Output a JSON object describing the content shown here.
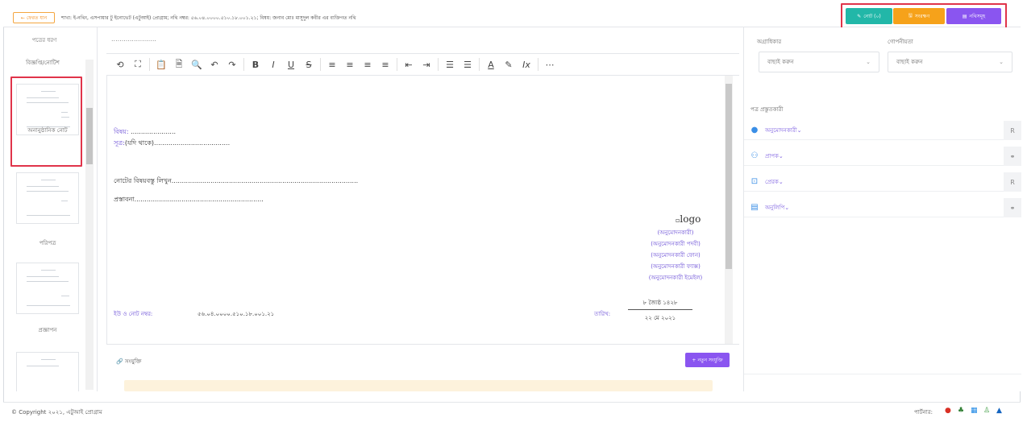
{
  "header": {
    "back_label": "ফেরত যান",
    "breadcrumb": "শাখা: ই-নথিং, এসপায়ার টু ইনোভেট (এটুআই) প্রোগ্রাম; নথি নম্বর: ৫৬.০৪.০০০০.৫১০.১৮.০০১.২১; বিষয়: জনাব মোঃ মাসুদুল কবীর এর ব্যক্তিগত নথি",
    "buttons": [
      {
        "label": "নোট (০)",
        "color": "#22b7a8"
      },
      {
        "label": "সংরক্ষণ",
        "color": "#f6a21a"
      },
      {
        "label": "নথিসমূহ",
        "color": "#8a55f0"
      }
    ]
  },
  "left": {
    "heading": "পত্রের ধরণ",
    "items": [
      {
        "label": "বিজ্ঞপ্তি/নোটিশ"
      },
      {
        "label": "অনানুষ্ঠানিক নোট"
      },
      {
        "label": "পরিপত্র"
      },
      {
        "label": "প্রজ্ঞাপন"
      }
    ]
  },
  "editor": {
    "top_dots": "......................",
    "toolbar": [
      "⟲",
      "⛶",
      "📋",
      "🗎",
      "🔍",
      "↶",
      "↷",
      "B",
      "I",
      "U",
      "S",
      "≡",
      "≡",
      "≡",
      "≡",
      "⇤",
      "⇥",
      "☰",
      "☰",
      "A",
      "✎",
      "Ix",
      "⋯"
    ],
    "subject_label": "বিষয়:",
    "subject_dots": "......................",
    "ref_label": "সূত্র:",
    "ref_text": "(যদি থাকে).....................................",
    "note_text": "নোটের বিষয়বস্তু লিখুন...........................................................................................",
    "proposal_text": "প্রস্তাবনা...............................................................",
    "logo_alt": "logo",
    "approver_lines": [
      "(অনুমোদনকারী)",
      "(অনুমোদনকারী পদবী)",
      "(অনুমোদনকারী ফোন)",
      "(অনুমোদনকারী ফ্যাক্স)",
      "(অনুমোদনকারী ইমেইল)"
    ],
    "note_no_label": "ইউ ও নোট নম্বর:",
    "note_no_value": "৫৬.০৪.০০০০.৫১০.১৮.০০১.২১",
    "date_label": "তারিখ:",
    "date_bn": "৮ জ্যৈষ্ঠ ১৪২৮",
    "date_en": "২২ মে ২০২১"
  },
  "attachments": {
    "label": "সংযুক্তি",
    "new_label": "নতুন সংযুক্তি"
  },
  "right": {
    "priority_label": "অগ্রাধিকার",
    "priority_value": "বাছাই করুন",
    "secrecy_label": "গোপনীয়তা",
    "secrecy_value": "বাছাই করুন",
    "section_label": "পত্র প্রস্তুতকারী",
    "rows": [
      {
        "label": "অনুমোদনকারী",
        "icon": "user-icon"
      },
      {
        "label": "প্রাপক",
        "icon": "users-icon"
      },
      {
        "label": "প্রেরক",
        "icon": "sender-icon"
      },
      {
        "label": "অনুলিপি",
        "icon": "copy-icon"
      }
    ]
  },
  "footer": {
    "copyright": "© Copyright ২০২১, এটুআই প্রোগ্রাম",
    "partner_label": "পার্টনার:"
  }
}
